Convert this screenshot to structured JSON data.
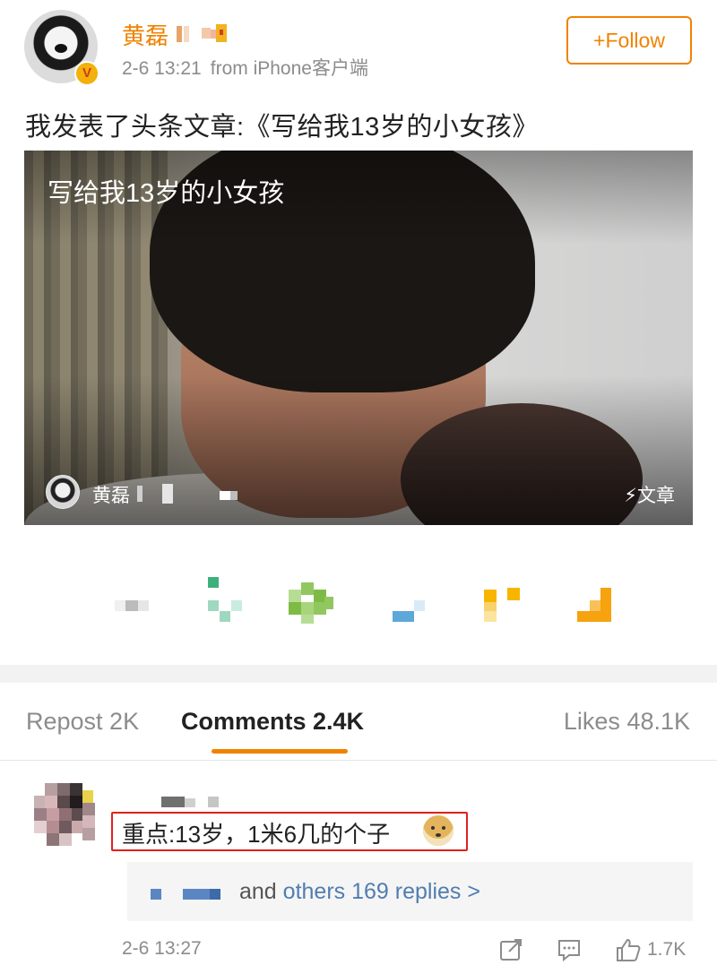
{
  "post": {
    "author": "黄磊",
    "time": "2-6 13:21",
    "source": "from iPhone客户端",
    "follow_label": "+Follow",
    "text": "我发表了头条文章:《写给我13岁的小女孩》",
    "verified_badge": "V"
  },
  "article_card": {
    "title": "写给我13岁的小女孩",
    "author": "黄磊",
    "tag": "文章",
    "tag_icon": "⚡"
  },
  "tabs": {
    "repost": "Repost 2K",
    "comments": "Comments 2.4K",
    "likes": "Likes 48.1K"
  },
  "comment": {
    "text": "重点:13岁，1米6几的个子",
    "emoji": "doge-emoji",
    "replies_prefix": "and ",
    "replies_link": "others 169 replies >",
    "time": "2-6 13:27",
    "like_count": "1.7K"
  },
  "colors": {
    "accent": "#f18200",
    "link": "#507daf",
    "highlight_box": "#e0211b"
  }
}
